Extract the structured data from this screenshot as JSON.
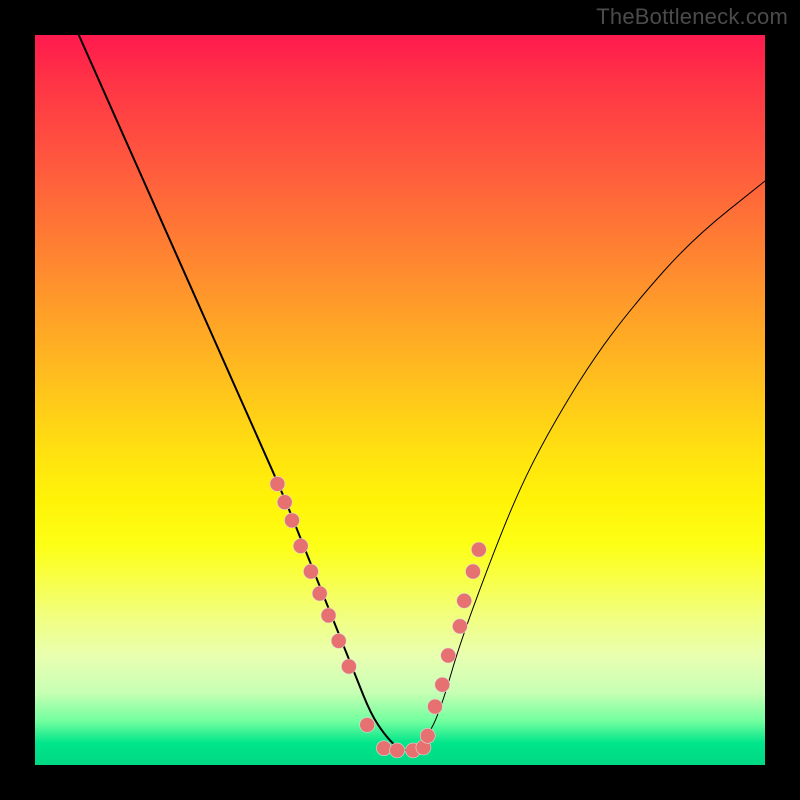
{
  "watermark": "TheBottleneck.com",
  "chart_data": {
    "type": "line",
    "title": "",
    "xlabel": "",
    "ylabel": "",
    "xlim": [
      0,
      100
    ],
    "ylim": [
      0,
      100
    ],
    "grid": false,
    "legend": false,
    "series": [
      {
        "name": "curve",
        "x": [
          6,
          10,
          14,
          18,
          22,
          26,
          30,
          34,
          36,
          38,
          40,
          42,
          44,
          46,
          48,
          50,
          52,
          54,
          56,
          58,
          62,
          66,
          70,
          76,
          82,
          90,
          100
        ],
        "y": [
          100,
          91,
          82,
          73,
          64,
          55,
          46,
          37,
          32,
          27,
          22,
          17,
          12,
          7,
          4,
          2,
          2,
          4,
          9,
          16,
          27,
          37,
          45,
          55,
          63,
          72,
          80
        ]
      }
    ],
    "points": {
      "name": "highlighted-dots",
      "x": [
        33.2,
        34.2,
        35.2,
        36.4,
        37.8,
        39.0,
        40.2,
        41.6,
        43.0,
        45.5,
        47.8,
        49.6,
        51.8,
        53.2,
        53.8,
        54.8,
        55.8,
        56.6,
        58.2,
        58.8,
        60.0,
        60.8
      ],
      "y": [
        38.5,
        36.0,
        33.5,
        30.0,
        26.5,
        23.5,
        20.5,
        17.0,
        13.5,
        5.5,
        2.3,
        2.0,
        2.0,
        2.4,
        4.0,
        8.0,
        11.0,
        15.0,
        19.0,
        22.5,
        26.5,
        29.5
      ]
    },
    "background_gradient": {
      "top": "#ff1a4e",
      "mid": "#ffe40f",
      "bottom": "#00d884"
    }
  }
}
